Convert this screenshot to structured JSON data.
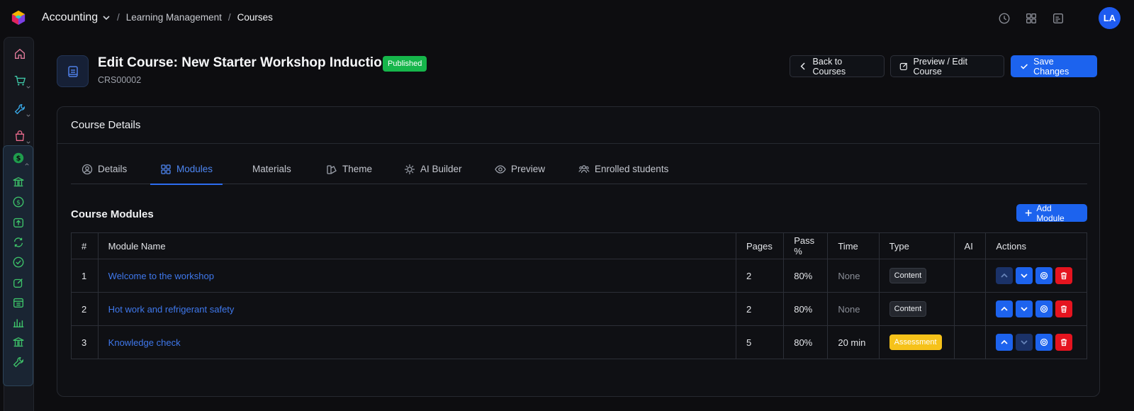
{
  "topbar": {
    "app_name": "Accounting",
    "breadcrumb": [
      "Learning Management",
      "Courses"
    ],
    "avatar_initials": "LA"
  },
  "header": {
    "title": "Edit Course: New Starter Workshop Induction",
    "status": "Published",
    "course_code": "CRS00002",
    "back_label": "Back to Courses",
    "preview_label": "Preview / Edit Course",
    "save_label": "Save Changes"
  },
  "card": {
    "title": "Course Details",
    "tabs": [
      {
        "label": "Details",
        "icon": "user-circle-icon"
      },
      {
        "label": "Modules",
        "icon": "grid-icon"
      },
      {
        "label": "Materials",
        "icon": ""
      },
      {
        "label": "Theme",
        "icon": "palette-icon"
      },
      {
        "label": "AI Builder",
        "icon": "ai-icon"
      },
      {
        "label": "Preview",
        "icon": "eye-icon"
      },
      {
        "label": "Enrolled students",
        "icon": "users-icon"
      }
    ],
    "active_tab": "Modules"
  },
  "modules": {
    "title": "Course Modules",
    "add_label": "Add Module",
    "columns": [
      "#",
      "Module Name",
      "Pages",
      "Pass %",
      "Time",
      "Type",
      "AI",
      "Actions"
    ],
    "rows": [
      {
        "num": "1",
        "name": "Welcome to the workshop",
        "pages": "2",
        "pass": "80%",
        "time": "None",
        "type": "Content",
        "ai": ""
      },
      {
        "num": "2",
        "name": "Hot work and refrigerant safety",
        "pages": "2",
        "pass": "80%",
        "time": "None",
        "type": "Content",
        "ai": ""
      },
      {
        "num": "3",
        "name": "Knowledge check",
        "pages": "5",
        "pass": "80%",
        "time": "20 min",
        "type": "Assessment",
        "ai": ""
      }
    ]
  },
  "colors": {
    "primary": "#1c63ee",
    "published": "#16b64b",
    "assessment": "#f6c21a",
    "danger": "#e5141f"
  }
}
